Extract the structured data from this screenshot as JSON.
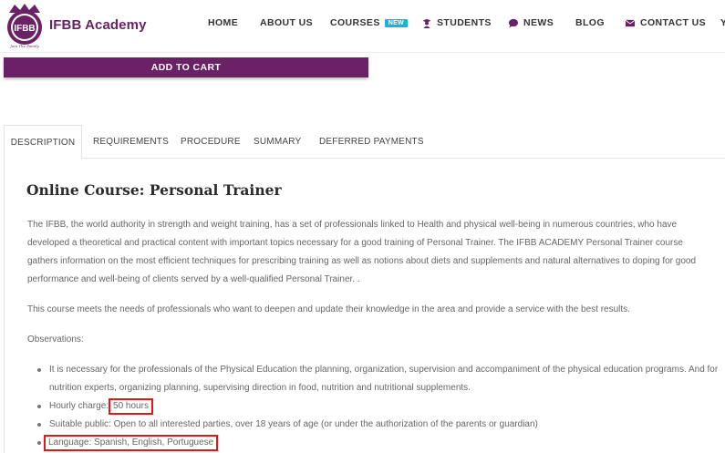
{
  "brand": {
    "name": "IFBB Academy",
    "logo_text": "IFBB",
    "logo_tagline": "Join The Family"
  },
  "nav": {
    "items": [
      {
        "label": "HOME"
      },
      {
        "label": "ABOUT US"
      },
      {
        "label": "COURSES",
        "badge": "NEW"
      },
      {
        "label": "STUDENTS",
        "icon": "student-icon"
      },
      {
        "label": "NEWS",
        "icon": "chat-bubble-icon"
      },
      {
        "label": "BLOG"
      },
      {
        "label": "CONTACT US",
        "icon": "envelope-icon"
      },
      {
        "label": "Y"
      }
    ]
  },
  "cart": {
    "label": "ADD TO CART"
  },
  "tabs": [
    {
      "label": "DESCRIPTION",
      "active": true
    },
    {
      "label": "REQUIREMENTS"
    },
    {
      "label": "PROCEDURE"
    },
    {
      "label": "SUMMARY"
    },
    {
      "label": "DEFERRED PAYMENTS"
    }
  ],
  "content": {
    "title": "Online Course: Personal Trainer",
    "paragraph1": "The IFBB, the world authority in strength and weight training, has a set of professionals linked to Health and physical well-being in numerous countries, who have developed a theoretical and practical content with important topics necessary for a good training of Personal Trainer. The IFBB ACADEMY Personal Trainer course gathers information on the most efficient techniques for prescribing training as well as notions about diets and supplements and natural alternatives to doping for good performance and well-being of clients served by a well-qualified Personal Trainer. .",
    "paragraph2": "This course meets the needs of professionals who want to deepen and update their knowledge in the area and provide a service with the best results.",
    "observations_label": "Observations:",
    "observations": {
      "item1": "It is necessary for the professionals of the Physical Education the planning, organization, supervision and accompaniment of the physical education programs. And for nutrition experts, organizing planning, supervising direction in food, nutrition and nutritional supplements.",
      "item2_label": "Hourly charge:",
      "item2_value": "50 hours",
      "item3": "Suitable public: Open to all interested parties, over 18 years of age (or under the authorization of the parents or guardian)",
      "item4": "Language: Spanish, English, Portuguese"
    }
  },
  "colors": {
    "brand": "#6b2166",
    "badge": "#19b5d6",
    "highlight": "#e3161c"
  }
}
